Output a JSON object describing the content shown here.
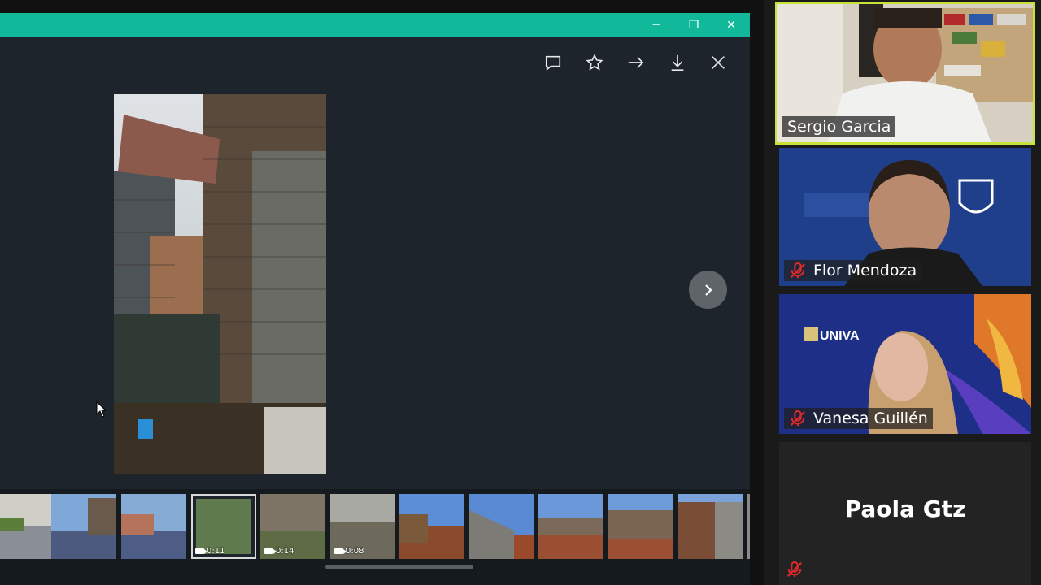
{
  "window": {
    "controls": {
      "minimize": "─",
      "maximize": "❐",
      "close": "✕"
    }
  },
  "toolbar": {
    "icons": [
      "comment-icon",
      "star-icon",
      "share-arrow-icon",
      "download-icon",
      "close-icon"
    ]
  },
  "thumbnails": [
    {
      "label": "",
      "type": "photo"
    },
    {
      "label": "",
      "type": "photo"
    },
    {
      "label": "",
      "type": "photo"
    },
    {
      "label": "0:11",
      "type": "video"
    },
    {
      "label": "0:14",
      "type": "video"
    },
    {
      "label": "0:08",
      "type": "video"
    },
    {
      "label": "",
      "type": "photo"
    },
    {
      "label": "",
      "type": "photo"
    },
    {
      "label": "",
      "type": "photo"
    },
    {
      "label": "",
      "type": "photo"
    },
    {
      "label": "",
      "type": "photo"
    }
  ],
  "participants": [
    {
      "name": "Sergio Garcia",
      "muted": false,
      "active_speaker": true
    },
    {
      "name": "Flor Mendoza",
      "muted": true,
      "active_speaker": false
    },
    {
      "name": "Vanesa Guillén",
      "muted": true,
      "active_speaker": false
    },
    {
      "name": "Paola Gtz",
      "muted": true,
      "active_speaker": false
    }
  ],
  "logos": {
    "univa": "UNIVA"
  },
  "colors": {
    "titlebar": "#12b89a",
    "active_speaker_border": "#c7e33a",
    "mute_red": "#e02a2a"
  }
}
